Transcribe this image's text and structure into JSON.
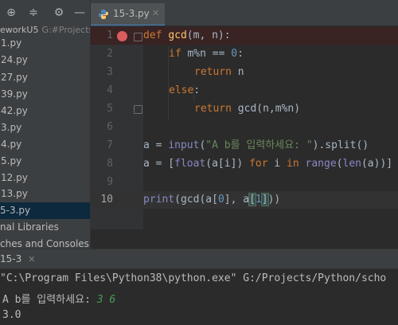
{
  "project": {
    "root_name": "eworkU5",
    "root_path": "G:#Projects"
  },
  "tree": [
    {
      "label": "1.py"
    },
    {
      "label": "24.py"
    },
    {
      "label": "27.py"
    },
    {
      "label": "39.py"
    },
    {
      "label": "42.py"
    },
    {
      "label": "3.py"
    },
    {
      "label": "4.py"
    },
    {
      "label": "5.py"
    },
    {
      "label": "12.py"
    },
    {
      "label": "13.py"
    },
    {
      "label": "5-3.py"
    },
    {
      "label": "nal Libraries"
    },
    {
      "label": "ches and Consoles"
    }
  ],
  "editor": {
    "active_tab": "15-3.py",
    "line_numbers": [
      "1",
      "2",
      "3",
      "4",
      "5",
      "6",
      "7",
      "8",
      "9",
      "10"
    ],
    "code": {
      "l1_def": "def ",
      "l1_fn": "gcd",
      "l1_rest": "(m, n):",
      "l2_kw": "if ",
      "l2_a": "m%n == ",
      "l2_num": "0",
      "l2_b": ":",
      "l3_kw": "return ",
      "l3_rest": "n",
      "l4_kw": "else",
      "l4_rest": ":",
      "l5_kw": "return ",
      "l5_rest": "gcd(n,m%n)",
      "l7_a": "a = ",
      "l7_bi": "input",
      "l7_p": "(",
      "l7_str": "\"A b를 입력하세요: \"",
      "l7_rest": ").split()",
      "l8_a": "a = [",
      "l8_bi1": "float",
      "l8_b": "(a[i]) ",
      "l8_kw1": "for ",
      "l8_c": "i ",
      "l8_kw2": "in ",
      "l8_bi2": "range",
      "l8_d": "(",
      "l8_bi3": "len",
      "l8_e": "(a))]",
      "l10_bi": "print",
      "l10_a": "(gcd(a[",
      "l10_n0": "0",
      "l10_b": "], a",
      "l10_br1": "[",
      "l10_n1": "1",
      "l10_br2": "]",
      "l10_c": "))"
    }
  },
  "run": {
    "tab_label": "15-3",
    "console": {
      "line1": "\"C:\\Program Files\\Python38\\python.exe\" G:/Projects/Python/scho",
      "prompt": "A b를 입력하세요: ",
      "user_input": "3 6",
      "output": "3.0"
    }
  },
  "colors": {
    "breakpoint": "#db5c5c",
    "breakpoint_line": "#3a2323",
    "active_line": "#323232",
    "selection": "#0d293e"
  }
}
